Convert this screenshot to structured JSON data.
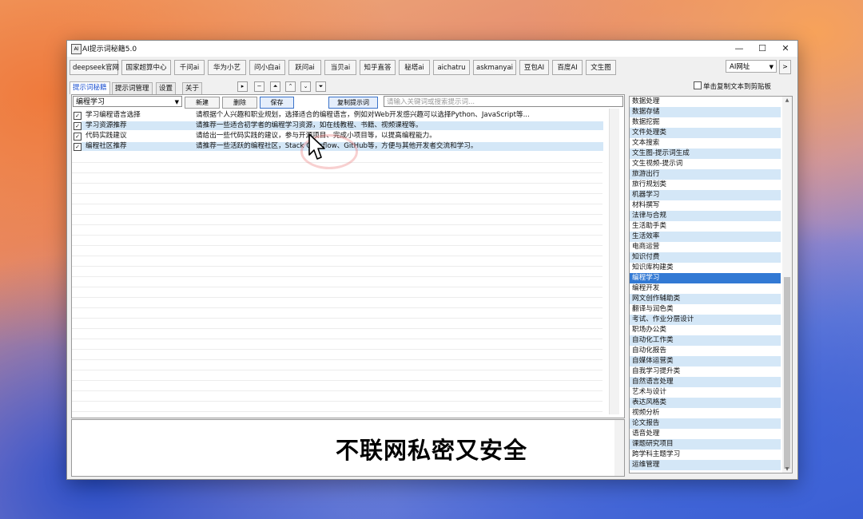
{
  "window": {
    "title": "AI提示词秘籍5.0"
  },
  "toolbar": {
    "buttons": [
      "deepseek官网",
      "国家超算中心",
      "千问ai",
      "华为小艺",
      "问小白ai",
      "跃问ai",
      "当贝ai",
      "知乎直答",
      "秘塔ai",
      "aichatru",
      "askmanyai",
      "豆包AI",
      "百度AI",
      "文生图"
    ],
    "dropdown_value": "AI网址",
    "next_symbol": ">"
  },
  "tabs": [
    "提示词秘籍",
    "提示词管理",
    "设置",
    "关于"
  ],
  "arrows": [
    "▸",
    "−",
    "⏶",
    "⌃",
    "⌄",
    "⏷"
  ],
  "copy_checkbox_label": "单击复制文本到剪贴板",
  "editor": {
    "category_select": "编程学习",
    "new_label": "新建",
    "delete_label": "删除",
    "save_label": "保存",
    "copy_prompt_label": "复制提示词",
    "search_placeholder": "请输入关键词或搜索提示词..."
  },
  "prompts": [
    {
      "name": "学习编程语言选择",
      "content": "请根据个人兴趣和职业规划，选择适合的编程语言，例如对Web开发感兴趣可以选择Python、JavaScript等..."
    },
    {
      "name": "学习资源推荐",
      "content": "请推荐一些适合初学者的编程学习资源，如在线教程、书籍、视频课程等。"
    },
    {
      "name": "代码实践建议",
      "content": "请给出一些代码实践的建议，参与开源项目、完成小项目等，以提高编程能力。"
    },
    {
      "name": "编程社区推荐",
      "content": "请推荐一些活跃的编程社区，Stack Overflow、GitHub等，方便与其他开发者交流和学习。"
    }
  ],
  "categories": [
    "数据处理",
    "数据存储",
    "数据挖掘",
    "文件处理类",
    "文本搜索",
    "文生图-提示词生成",
    "文生视频-提示词",
    "旅游出行",
    "旅行规划类",
    "机器学习",
    "材料撰写",
    "法律与合规",
    "生活助手类",
    "生活效率",
    "电商运营",
    "知识付费",
    "知识库构建类",
    "编程学习",
    "编程开发",
    "网文创作辅助类",
    "翻译与润色类",
    "考试、作业分层设计",
    "职场办公类",
    "自动化工作类",
    "自动化报告",
    "自媒体运营类",
    "自我学习提升类",
    "自然语言处理",
    "艺术与设计",
    "表达风格类",
    "视频分析",
    "论文报告",
    "语音处理",
    "课题研究项目",
    "跨学科主题学习",
    "运维管理"
  ],
  "selected_category": "编程学习",
  "caption": "不联网私密又安全"
}
